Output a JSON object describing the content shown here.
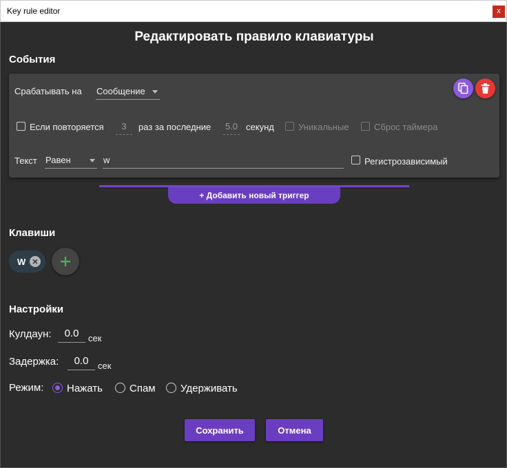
{
  "window": {
    "title": "Key rule editor",
    "close_label": "x"
  },
  "page": {
    "heading": "Редактировать правило клавиатуры"
  },
  "events": {
    "section_title": "События",
    "trigger": {
      "on_label": "Срабатывать на",
      "on_value": "Сообщение",
      "repeat_label": "Если повторяется",
      "repeat_count": "3",
      "repeat_mid": "раз за последние",
      "repeat_seconds": "5.0",
      "repeat_unit": "секунд",
      "unique_label": "Уникальные",
      "reset_label": "Сброс таймера",
      "text_label": "Текст",
      "text_operator": "Равен",
      "text_value": "w",
      "case_label": "Регистрозависимый",
      "repeat_checked": false,
      "unique_checked": false,
      "reset_checked": false,
      "case_checked": false
    },
    "add_trigger_label": "+ Добавить новый триггер",
    "copy_icon": "copy-icon",
    "delete_icon": "trash-icon"
  },
  "keys": {
    "section_title": "Клавиши",
    "items": [
      {
        "label": "W"
      }
    ],
    "add_icon": "plus-icon"
  },
  "settings": {
    "section_title": "Настройки",
    "cooldown_label": "Кулдаун:",
    "cooldown_value": "0.0",
    "cooldown_unit": "сек",
    "delay_label": "Задержка:",
    "delay_value": "0.0",
    "delay_unit": "сек",
    "mode_label": "Режим:",
    "modes": [
      {
        "label": "Нажать",
        "selected": true
      },
      {
        "label": "Спам",
        "selected": false
      },
      {
        "label": "Удерживать",
        "selected": false
      }
    ]
  },
  "actions": {
    "save_label": "Сохранить",
    "cancel_label": "Отмена"
  },
  "colors": {
    "accent": "#6a3ec1",
    "copy_button": "#8a5ae0",
    "delete_button": "#e53935",
    "add_key_icon": "#4caf50",
    "background": "#2c2c2c",
    "card": "#424242"
  }
}
